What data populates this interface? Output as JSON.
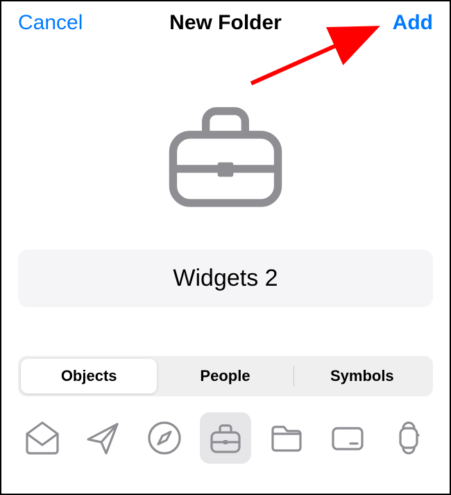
{
  "header": {
    "cancel": "Cancel",
    "title": "New Folder",
    "add": "Add"
  },
  "folder": {
    "name": "Widgets 2",
    "selected_icon": "briefcase"
  },
  "segmented": {
    "tabs": [
      "Objects",
      "People",
      "Symbols"
    ],
    "active_index": 0
  },
  "icons": [
    {
      "name": "envelope-icon",
      "selected": false
    },
    {
      "name": "paperplane-icon",
      "selected": false
    },
    {
      "name": "compass-icon",
      "selected": false
    },
    {
      "name": "briefcase-icon",
      "selected": true
    },
    {
      "name": "folder-icon",
      "selected": false
    },
    {
      "name": "creditcard-icon",
      "selected": false
    },
    {
      "name": "watch-icon",
      "selected": false
    }
  ],
  "colors": {
    "accent": "#007aff",
    "icon_gray": "#8e8e93",
    "segment_bg": "#efeff0",
    "input_bg": "#f5f5f7",
    "annotation": "#ff0000"
  }
}
